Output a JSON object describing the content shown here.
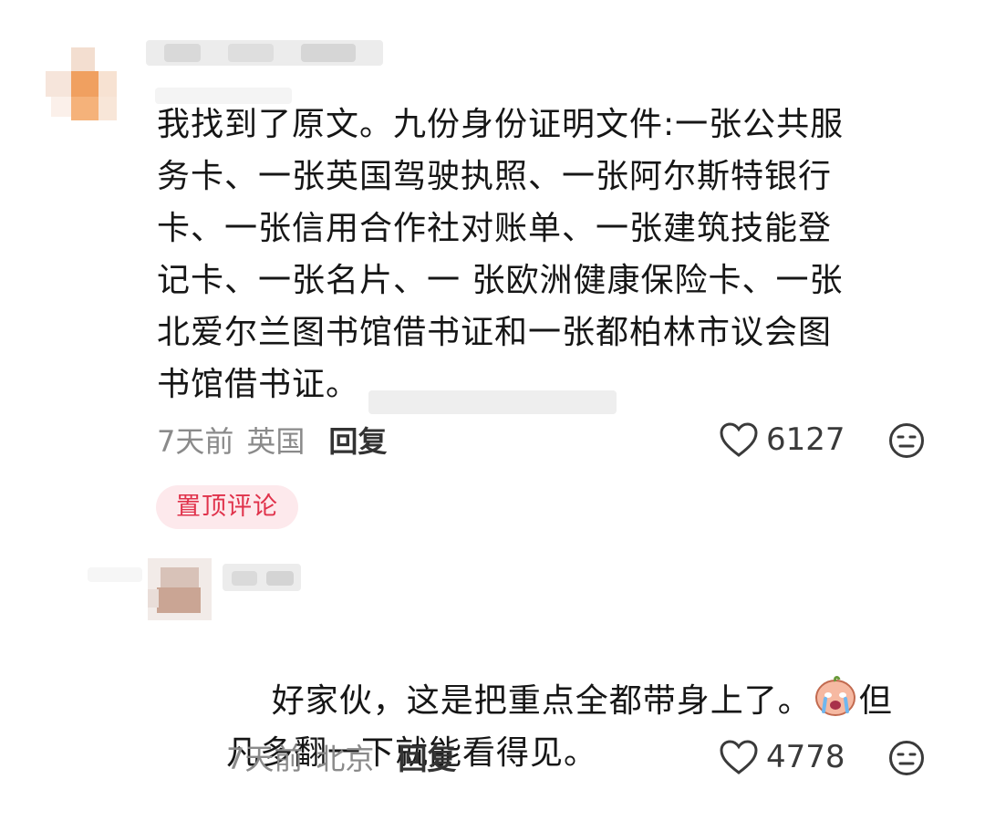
{
  "comments": [
    {
      "text": "我找到了原文。九份身份证明文件:一张公共服\n务卡、一张英国驾驶执照、一张阿尔斯特银行\n卡、一张信用合作社对账单、一张建筑技能登\n记卡、一张名片、一 张欧洲健康保险卡、一张\n北爱尔兰图书馆借书证和一张都柏林市议会图\n书馆借书证。",
      "time": "7天前",
      "location": "英国",
      "reply_label": "回复",
      "likes": "6127",
      "badge": "置顶评论"
    },
    {
      "text": "好家伙，这是把重点全都带身上了。",
      "text_after_emoji": "但\n凡多翻一下就能看得见。",
      "time": "7天前",
      "location": "北京",
      "reply_label": "回复",
      "likes": "4778"
    }
  ],
  "icons": {
    "like": "heart-outline-icon",
    "reaction": "neutral-face-icon",
    "inline_emoji": "crying-peach-emoji"
  },
  "colors": {
    "text": "#161616",
    "meta": "#8a8a8a",
    "badge_bg": "#fde9ec",
    "badge_text": "#e0324b"
  }
}
